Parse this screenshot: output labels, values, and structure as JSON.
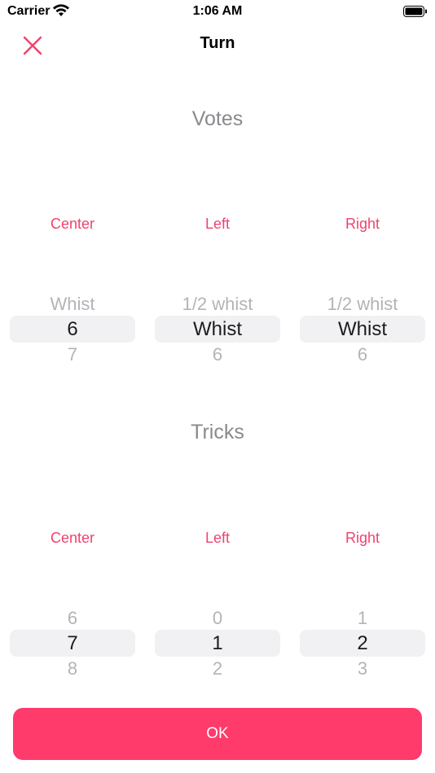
{
  "status": {
    "carrier": "Carrier",
    "time": "1:06 AM"
  },
  "nav": {
    "title": "Turn"
  },
  "votes": {
    "title": "Votes",
    "columns": [
      {
        "label": "Center",
        "above": "Whist",
        "selected": "6",
        "below": "7"
      },
      {
        "label": "Left",
        "above": "1/2 whist",
        "selected": "Whist",
        "below": "6"
      },
      {
        "label": "Right",
        "above": "1/2 whist",
        "selected": "Whist",
        "below": "6"
      }
    ]
  },
  "tricks": {
    "title": "Tricks",
    "columns": [
      {
        "label": "Center",
        "above": "6",
        "selected": "7",
        "below": "8"
      },
      {
        "label": "Left",
        "above": "0",
        "selected": "1",
        "below": "2"
      },
      {
        "label": "Right",
        "above": "1",
        "selected": "2",
        "below": "3"
      }
    ]
  },
  "ok_button": {
    "label": "OK"
  },
  "colors": {
    "accent": "#f0426e",
    "button": "#ff3b6b",
    "section_title": "#8a8a8e"
  }
}
